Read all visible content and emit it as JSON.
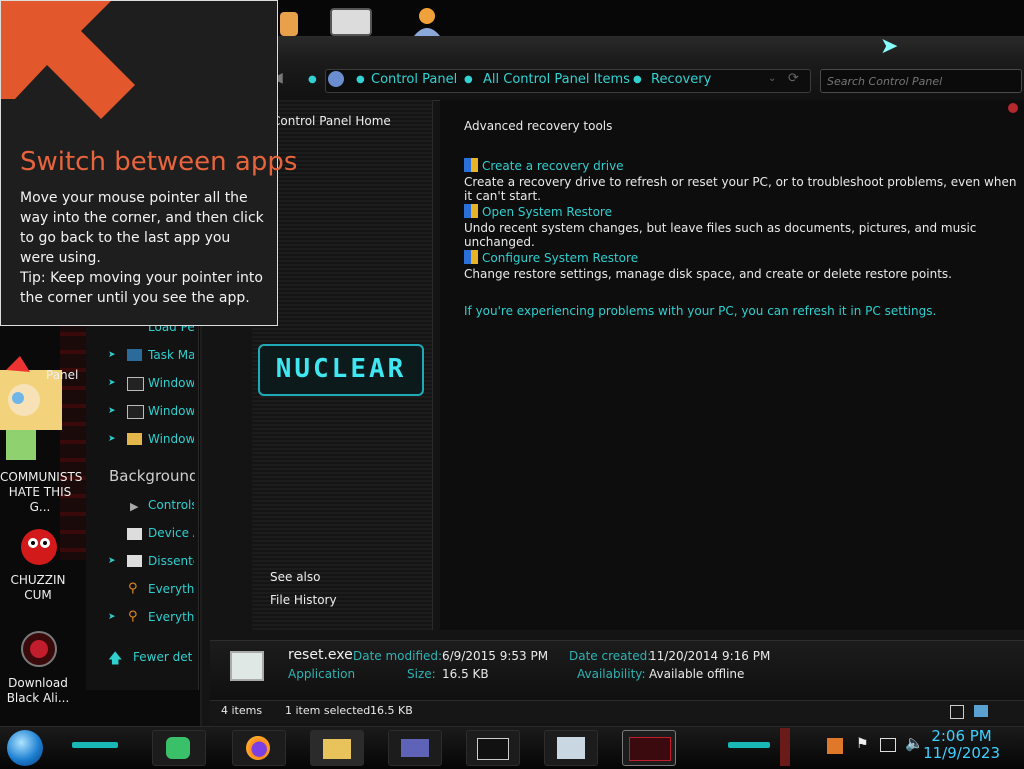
{
  "toast": {
    "title": "Switch between apps",
    "body": "Move your mouse pointer all the way into the corner, and then click to go back to the last app you were using.",
    "tip": "Tip: Keep moving your pointer into the corner until you see the app."
  },
  "address_bar": {
    "crumbs": [
      "Control Panel",
      "All Control Panel Items",
      "Recovery"
    ]
  },
  "search": {
    "placeholder": "Search Control Panel"
  },
  "nav_pane": {
    "home": "Control Panel Home",
    "logo": "NUCLEAR",
    "see_also": "See also",
    "file_history": "File History"
  },
  "content": {
    "heading": "Advanced recovery tools",
    "items": [
      {
        "link": "Create a recovery drive",
        "desc": "Create a recovery drive to refresh or reset your PC, or to troubleshoot problems, even when it can't start."
      },
      {
        "link": "Open System Restore",
        "desc": "Undo recent system changes, but leave files such as documents, pictures, and music unchanged."
      },
      {
        "link": "Configure System Restore",
        "desc": "Change restore settings, manage disk space, and create or delete restore points."
      }
    ],
    "footer_link": "If you're experiencing problems with your PC, you can refresh it in PC settings."
  },
  "details": {
    "filename": "reset.exe",
    "filetype": "Application",
    "date_modified_label": "Date modified:",
    "date_modified": "6/9/2015 9:53 PM",
    "size_label": "Size:",
    "size": "16.5 KB",
    "date_created_label": "Date created:",
    "date_created": "11/20/2014 9:16 PM",
    "availability_label": "Availability:",
    "availability": "Available offline"
  },
  "status_bar": {
    "count": "4 items",
    "selection": "1 item selected",
    "selection_size": "16.5 KB"
  },
  "left_pane": {
    "items_top": [
      "Load Per",
      "Task Ma",
      "Window",
      "Window",
      "Window"
    ],
    "section": "Background",
    "items_bottom": [
      "Controls",
      "Device A",
      "Dissente",
      "Everythi",
      "Everythi"
    ],
    "fewer": "Fewer deta"
  },
  "desktop": {
    "panel_label": "Panel",
    "icons": [
      {
        "label": "COMMUNISTS HATE THIS G..."
      },
      {
        "label": "CHUZZIN CUM"
      },
      {
        "label": "Download Black Ali..."
      }
    ]
  },
  "clock": {
    "time": "2:06 PM",
    "date": "11/9/2023"
  },
  "colors": {
    "accent": "#30cfcf",
    "toast_title": "#e8643c",
    "clock": "#3fd0ff"
  }
}
